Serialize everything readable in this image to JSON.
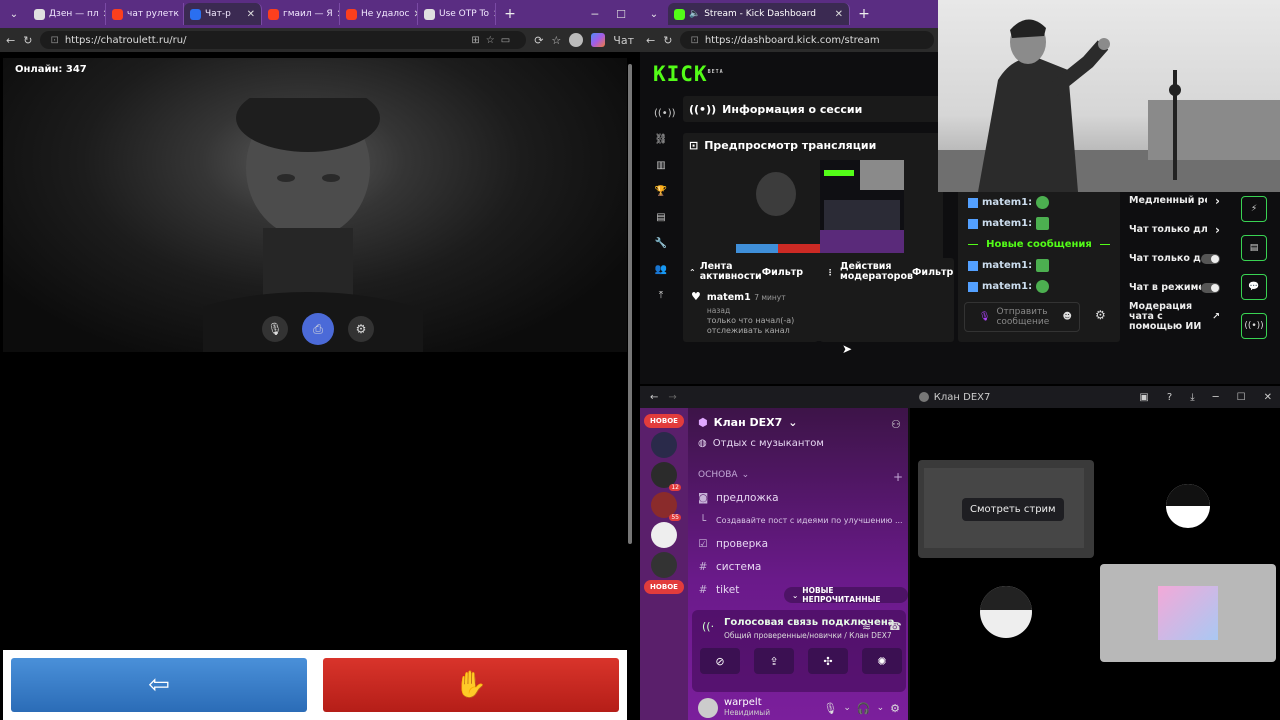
{
  "left_browser": {
    "tabs": [
      {
        "label": "Дзен — пл",
        "color": "#e0e0e0"
      },
      {
        "label": "чат рулетк",
        "color": "#fc3f1d"
      },
      {
        "label": "Чат-р",
        "color": "#2a6ff0"
      },
      {
        "label": "гмаил — Я",
        "color": "#fc3f1d"
      },
      {
        "label": "Не удалос",
        "color": "#fc3f1d"
      },
      {
        "label": "Use OTP To",
        "color": "#e0e0e0"
      }
    ],
    "url": "https://chatroulett.ru/ru/",
    "profile_label": "Чат"
  },
  "chatroulette": {
    "online": "Онлайн: 347"
  },
  "right_browser": {
    "tab_title": "Stream - Kick Dashboard",
    "url": "https://dashboard.kick.com/stream"
  },
  "kick": {
    "logo": "KICK",
    "beta": "BETA",
    "session_info": "Информация о сессии",
    "preview": "Предпросмотр трансляции",
    "activity_feed": "Лента активности",
    "filter": "Фильтр",
    "mod_actions": "Действия модераторов",
    "feed_user": "matem1",
    "feed_time": "7 минут назад",
    "feed_text": "только что начал(-а) отслеживать канал",
    "chat_user": "matem1:",
    "new_messages": "Новые сообщения",
    "send_placeholder": "Отправить сообщение",
    "settings": [
      {
        "label": "Медленный режим",
        "control": "chevron"
      },
      {
        "label": "Чат только для фолловеров",
        "control": "chevron"
      },
      {
        "label": "Чат только для подписчиков",
        "control": "toggle"
      },
      {
        "label": "Чат в режиме эмодзи",
        "control": "toggle"
      },
      {
        "label": "Модерация чата с помощью ИИ",
        "control": "link"
      }
    ]
  },
  "discord": {
    "window_title": "Клан DEX7",
    "server_name": "Клан DEX7",
    "new_badge": "НОВОЕ",
    "event": "Отдых с музыкантом",
    "category": "ОСНОВА",
    "channels": [
      {
        "name": "предложка",
        "icon": "forum"
      },
      {
        "name": "Создавайте пост с идеями по улучшению ...",
        "icon": "sub"
      },
      {
        "name": "проверка",
        "icon": "check"
      },
      {
        "name": "система",
        "icon": "#"
      },
      {
        "name": "tiket",
        "icon": "#"
      }
    ],
    "unread_pill": "НОВЫЕ НЕПРОЧИТАННЫЕ",
    "server_badges": [
      "12",
      "55"
    ],
    "voice_status": "Голосовая связь подключена",
    "voice_channel": "Общий проверенные/новички / Клан DEX7",
    "user_name": "warpelt",
    "user_status": "Невидимый",
    "watch_stream": "Смотреть стрим"
  }
}
